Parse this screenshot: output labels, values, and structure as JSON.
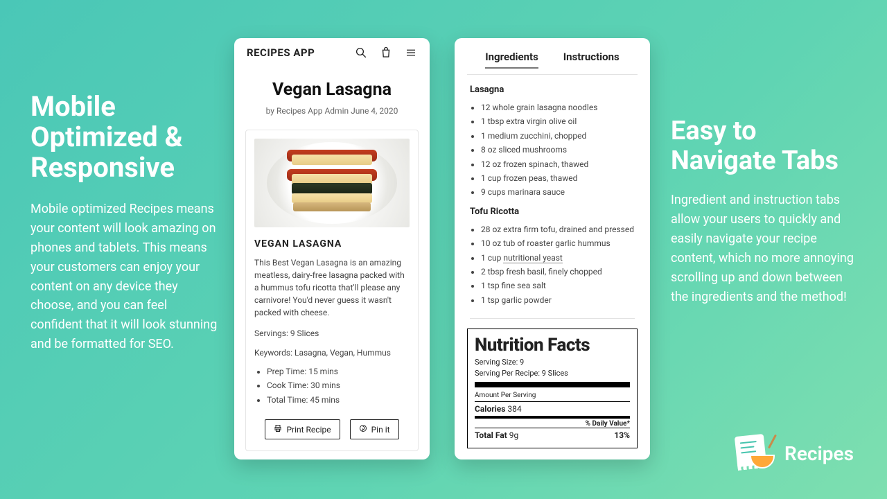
{
  "left": {
    "heading": "Mobile Optimized & Responsive",
    "body": "Mobile optimized Recipes means your content will look amazing on phones and tablets. This means your customers can enjoy your content on any device they choose, and you can feel confident that it will look stunning and be formatted for SEO."
  },
  "right": {
    "heading": "Easy to Navigate Tabs",
    "body": "Ingredient and instruction tabs allow your users to quickly and easily navigate your recipe content, which no more annoying scrolling up and down between the ingredients and the method!"
  },
  "phone1": {
    "brand": "RECIPES APP",
    "title": "Vegan Lasagna",
    "byline": "by Recipes App Admin   June 4, 2020",
    "card_title": "VEGAN LASAGNA",
    "desc": "This Best Vegan Lasagna is an amazing meatless, dairy-free lasagna packed with a hummus tofu ricotta that'll please any carnivore! You'd never guess it wasn't packed with cheese.",
    "servings": "Servings: 9 Slices",
    "keywords": "Keywords: Lasagna, Vegan, Hummus",
    "times": [
      "Prep Time: 15 mins",
      "Cook Time: 30 mins",
      "Total Time: 45 mins"
    ],
    "print": "Print Recipe",
    "pin": "Pin it"
  },
  "phone2": {
    "tab_ingredients": "Ingredients",
    "tab_instructions": "Instructions",
    "group1_title": "Lasagna",
    "group1": [
      "12 whole grain lasagna noodles",
      "1 tbsp extra virgin olive oil",
      "1 medium zucchini, chopped",
      "8 oz sliced mushrooms",
      "12 oz frozen spinach, thawed",
      "1 cup frozen peas, thawed",
      "9 cups marinara sauce"
    ],
    "group2_title": "Tofu Ricotta",
    "group2": [
      "28 oz extra firm tofu, drained and pressed",
      "10 oz tub of roaster garlic hummus",
      "1 cup nutritional yeast",
      "2 tbsp fresh basil, finely chopped",
      "1 tsp fine sea salt",
      "1 tsp garlic powder"
    ],
    "nut_title": "Nutrition Facts",
    "nut_serving_size": "Serving Size: 9",
    "nut_per_recipe": "Serving Per Recipe: 9 Slices",
    "nut_amount": "Amount Per Serving",
    "nut_calories_label": "Calories",
    "nut_calories_val": "384",
    "nut_dv": "% Daily Value*",
    "nut_fat_label": "Total Fat",
    "nut_fat_val": "9g",
    "nut_fat_pct": "13%"
  },
  "brand": {
    "name": "Recipes"
  }
}
